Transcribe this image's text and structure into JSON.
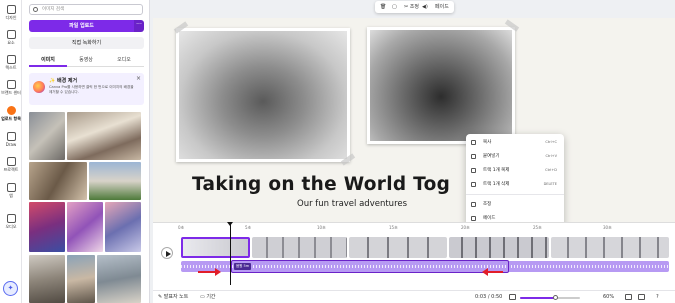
{
  "rail": {
    "items": [
      {
        "label": "디자인",
        "icon": "layout-icon"
      },
      {
        "label": "요소",
        "icon": "shapes-icon"
      },
      {
        "label": "텍스트",
        "icon": "text-icon"
      },
      {
        "label": "브랜드 센터",
        "icon": "brand-icon"
      },
      {
        "label": "업로드 항목",
        "icon": "upload-icon",
        "active": true
      },
      {
        "label": "Draw",
        "icon": "draw-icon"
      },
      {
        "label": "프로젝트",
        "icon": "folder-icon"
      },
      {
        "label": "앱",
        "icon": "apps-icon"
      },
      {
        "label": "오디오",
        "icon": "music-icon"
      }
    ]
  },
  "panel": {
    "search_placeholder": "이미지 검색",
    "upload_label": "파일 업로드",
    "upload_more": "···",
    "record_label": "직접 녹화하기",
    "tabs": [
      "이미지",
      "동영상",
      "오디오"
    ],
    "promo": {
      "title": "배경 제거",
      "desc": "Canva Pro를 사용하면 클릭 한 번으로 이미지의 배경을 제거할 수 있습니다.",
      "close": "×"
    }
  },
  "canvas_toolbar": {
    "delete_icon": "trash-icon",
    "copy_icon": "copy-icon",
    "adjust_label": "조정",
    "volume_icon": "volume-icon",
    "fade_label": "페이드"
  },
  "slide": {
    "headline": "Taking on the World Tog",
    "subline": "Our fun travel adventures"
  },
  "context_menu": {
    "items": [
      {
        "label": "복사",
        "shortcut": "Ctrl+C",
        "icon": "copy-icon"
      },
      {
        "label": "붙여넣기",
        "shortcut": "Ctrl+V",
        "icon": "paste-icon"
      },
      {
        "label": "트랙 1개 복제",
        "shortcut": "Ctrl+D",
        "icon": "duplicate-icon"
      },
      {
        "label": "트랙 1개 삭제",
        "shortcut": "DELETE",
        "icon": "trash-icon"
      },
      {
        "label": "조정",
        "shortcut": "",
        "icon": "scissors-icon"
      },
      {
        "label": "페이드",
        "shortcut": "",
        "icon": "fade-icon"
      },
      {
        "label": "Beat Sync",
        "shortcut": "",
        "icon": "beat-sync-icon"
      },
      {
        "label": "볼륨",
        "shortcut": "",
        "icon": "volume-icon"
      },
      {
        "label": "페이지 분할",
        "shortcut": "S",
        "icon": "split-icon"
      }
    ]
  },
  "timeline": {
    "ticks": [
      "0초",
      "5초",
      "10초",
      "15초",
      "20초",
      "25초",
      "30초",
      "35초",
      "40초",
      "45초",
      "50초"
    ],
    "audio_label": "음원 5m"
  },
  "bottombar": {
    "notes_label": "발표자 노트",
    "duration_label": "기간",
    "time": "0:03 / 0:50",
    "zoom": "60%",
    "zoom_value": 0.6
  },
  "colors": {
    "accent": "#7d2ae8",
    "audio_track": "#b79af3",
    "annotation_arrow": "#e11d2a",
    "upload_active": "#f97316"
  }
}
